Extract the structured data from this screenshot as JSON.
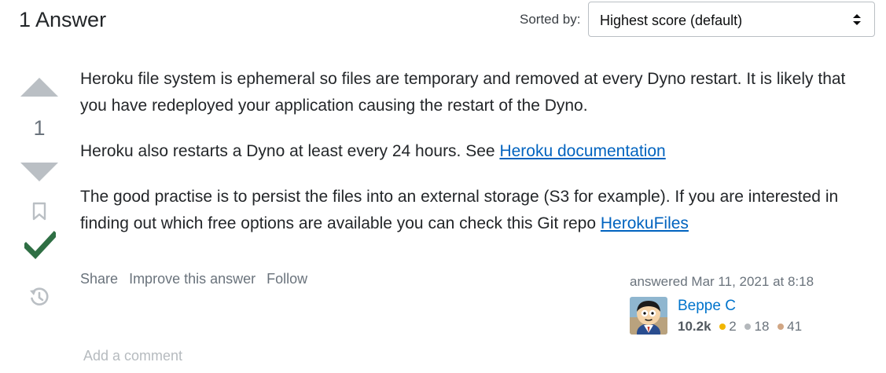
{
  "header": {
    "title": "1 Answer",
    "sort_label": "Sorted by:",
    "sort_value": "Highest score (default)"
  },
  "vote": {
    "count": "1"
  },
  "answer": {
    "p1": "Heroku file system is ephemeral so files are temporary and removed at every Dyno restart. It is likely that you have redeployed your application causing the restart of the Dyno.",
    "p2_text": "Heroku also restarts a Dyno at least every 24 hours. See ",
    "p2_link": "Heroku documentation",
    "p3_text": "The good practise is to persist the files into an external storage (S3 for example). If you are interested in finding out which free options are available you can check this Git repo ",
    "p3_link": "HerokuFiles"
  },
  "post_menu": {
    "share": "Share",
    "improve": "Improve this answer",
    "follow": "Follow"
  },
  "user_card": {
    "action": "answered Mar 11, 2021 at 8:18",
    "name": "Beppe C",
    "reputation": "10.2k",
    "gold": "2",
    "silver": "18",
    "bronze": "41"
  },
  "comments": {
    "add": "Add a comment"
  },
  "colors": {
    "link": "#0063bf",
    "accepted": "#2f6f44",
    "vote_arrow": "#babfc4",
    "gold": "#f1b600",
    "silver": "#9a9c9f",
    "bronze": "#ab825f"
  },
  "icons": {
    "sort": "up-down-chevron-icon",
    "upvote": "arrow-up-icon",
    "downvote": "arrow-down-icon",
    "bookmark": "bookmark-icon",
    "accepted": "checkmark-icon",
    "history": "history-icon"
  }
}
